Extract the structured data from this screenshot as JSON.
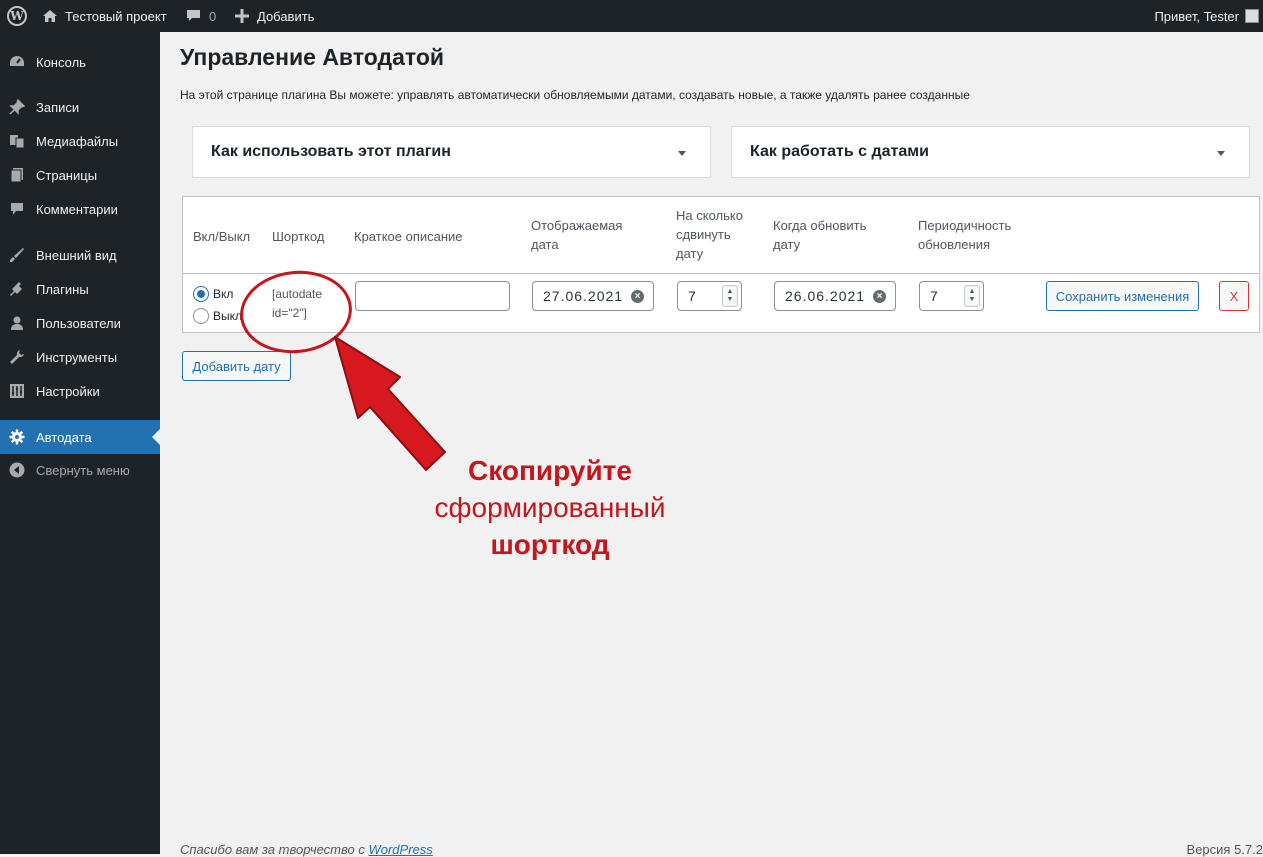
{
  "adminbar": {
    "site_name": "Тестовый проект",
    "comments_count": "0",
    "add_new": "Добавить",
    "howdy": "Привет, Tester"
  },
  "sidebar": {
    "items": [
      {
        "label": "Консоль",
        "icon": "dashboard-icon"
      },
      {
        "label": "Записи",
        "icon": "pin-icon"
      },
      {
        "label": "Медиафайлы",
        "icon": "media-icon"
      },
      {
        "label": "Страницы",
        "icon": "pages-icon"
      },
      {
        "label": "Комментарии",
        "icon": "comment-icon"
      },
      {
        "label": "Внешний вид",
        "icon": "brush-icon"
      },
      {
        "label": "Плагины",
        "icon": "plugin-icon"
      },
      {
        "label": "Пользователи",
        "icon": "user-icon"
      },
      {
        "label": "Инструменты",
        "icon": "wrench-icon"
      },
      {
        "label": "Настройки",
        "icon": "settings-icon"
      },
      {
        "label": "Автодата",
        "icon": "gear-icon",
        "current": true
      },
      {
        "label": "Свернуть меню",
        "icon": "collapse-icon"
      }
    ]
  },
  "main": {
    "title": "Управление Автодатой",
    "description": "На этой странице плагина Вы можете: управлять автоматически обновляемыми датами, создавать новые, а также удалять ранее созданные",
    "accordions": [
      {
        "label": "Как использовать этот плагин"
      },
      {
        "label": "Как работать с датами"
      }
    ],
    "table": {
      "headers": {
        "toggle": "Вкл/Выкл",
        "shortcode": "Шорткод",
        "desc": "Краткое описание",
        "display_date_1": "Отображаемая",
        "display_date_2": "дата",
        "shift_1": "На сколько",
        "shift_2": "сдвинуть",
        "shift_3": "дату",
        "update_1": "Когда обновить",
        "update_2": "дату",
        "period_1": "Периодичность",
        "period_2": "обновления"
      },
      "row": {
        "on_label": "Вкл",
        "off_label": "Выкл",
        "state": "on",
        "shortcode_1": "[autodate",
        "shortcode_2": "id=\"2\"]",
        "description_value": "",
        "display_date": "27.06.2021",
        "shift_value": "7",
        "update_date": "26.06.2021",
        "period_value": "7",
        "save_label": "Сохранить изменения",
        "delete_label": "X"
      }
    },
    "add_date_label": "Добавить дату"
  },
  "annotation": {
    "line1": "Скопируйте",
    "line2": "сформированный",
    "line3": "шорткод",
    "color": "#c4161c"
  },
  "footer": {
    "thanks_prefix": "Спасибо вам за творчество с",
    "thanks_link": "WordPress",
    "version": "Версия 5.7.2"
  },
  "colors": {
    "adminbar_bg": "#1d2327",
    "accent": "#2271b1",
    "danger": "#d63638"
  }
}
